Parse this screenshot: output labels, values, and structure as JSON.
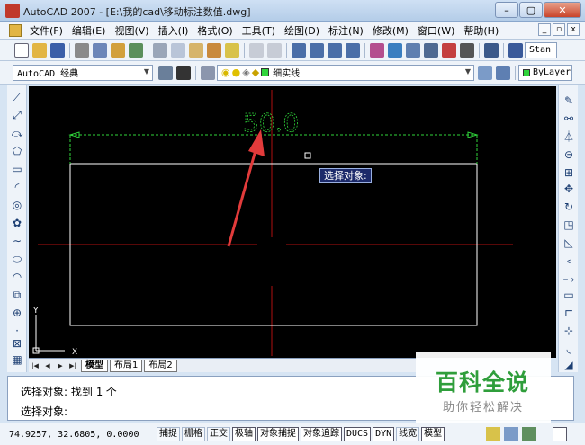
{
  "window": {
    "title": "AutoCAD 2007 - [E:\\我的cad\\移动标注数值.dwg]",
    "buttons": [
      "–",
      "▢",
      "✕"
    ],
    "mdi_buttons": [
      "_",
      "▫",
      "x"
    ]
  },
  "menu": [
    "文件(F)",
    "编辑(E)",
    "视图(V)",
    "插入(I)",
    "格式(O)",
    "工具(T)",
    "绘图(D)",
    "标注(N)",
    "修改(M)",
    "窗口(W)",
    "帮助(H)"
  ],
  "toolbar1": {
    "text_style_combo": "Stan"
  },
  "toolbar2": {
    "workspace": "AutoCAD 经典",
    "layer": "细实线",
    "color": "ByLayer"
  },
  "drawing": {
    "dimension_text": "50.0",
    "tooltip": "选择对象:",
    "ucs_y": "Y",
    "ucs_x": "X"
  },
  "tabs": [
    "模型",
    "布局1",
    "布局2"
  ],
  "command": {
    "line1_prefix": "选择对象: 找到",
    "line1_count": "1",
    "line1_suffix": "个",
    "line2": "选择对象:"
  },
  "status": {
    "coords": "74.9257,  32.6805, 0.0000",
    "buttons": [
      "捕捉",
      "栅格",
      "正交",
      "极轴",
      "对象捕捉",
      "对象追踪",
      "DUCS",
      "DYN",
      "线宽",
      "模型"
    ]
  },
  "watermark": {
    "title": "百科全说",
    "subtitle": "助你轻松解决"
  },
  "colors": {
    "canvas": "#000000",
    "axis_red": "#b01010",
    "dim_green": "#2fd43a",
    "arrow_red": "#e23b3b"
  }
}
